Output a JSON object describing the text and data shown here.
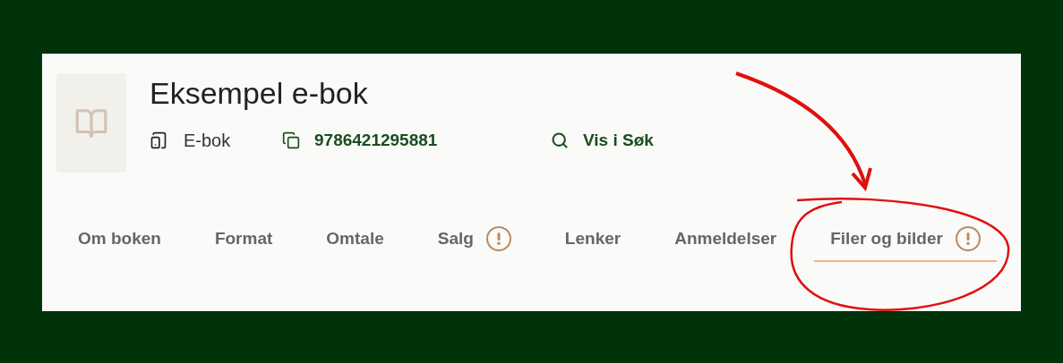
{
  "product": {
    "title": "Eksempel e-bok",
    "format": "E-bok",
    "isbn": "9786421295881",
    "search_link": "Vis i Søk"
  },
  "tabs": [
    {
      "label": "Om boken",
      "selected": false,
      "warning": false
    },
    {
      "label": "Format",
      "selected": false,
      "warning": false
    },
    {
      "label": "Omtale",
      "selected": false,
      "warning": false
    },
    {
      "label": "Salg",
      "selected": false,
      "warning": true
    },
    {
      "label": "Lenker",
      "selected": false,
      "warning": false
    },
    {
      "label": "Anmeldelser",
      "selected": false,
      "warning": false
    },
    {
      "label": "Filer og bilder",
      "selected": true,
      "warning": true
    }
  ]
}
